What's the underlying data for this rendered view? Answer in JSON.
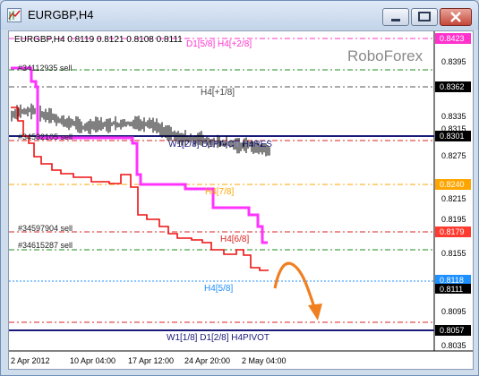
{
  "window": {
    "title": "EURGBP,H4"
  },
  "chart": {
    "info": "EURGBP,H4  0.8119 0.8121 0.8108 0.8111",
    "watermark": "RoboForex",
    "price_axis": {
      "ticks": [
        "0.8395",
        "0.8335",
        "0.8315",
        "0.8275",
        "0.8215",
        "0.8195",
        "0.8155",
        "0.8095",
        "0.8035"
      ]
    },
    "price_boxes": [
      {
        "value": "0.8423",
        "color": "#ff33cc"
      },
      {
        "value": "0.8362",
        "color": "#000000"
      },
      {
        "value": "0.8301",
        "color": "#000000"
      },
      {
        "value": "0.8240",
        "color": "#ffa500"
      },
      {
        "value": "0.8179",
        "color": "#ff3b30"
      },
      {
        "value": "0.8118",
        "color": "#1e90ff"
      },
      {
        "value": "0.8111",
        "color": "#000000"
      },
      {
        "value": "0.8057",
        "color": "#000000"
      }
    ],
    "time_axis": [
      "2 Apr 2012",
      "10 Apr 04:00",
      "17 Apr 12:00",
      "24 Apr 20:00",
      "2 May 04:00"
    ],
    "level_labels": {
      "d1_5_8": "D1[5/8] H4[+2/8]",
      "h4_1_8": "H4[+1/8]",
      "w1_pivot": "W1[2/8] D1PIVOT H4RES",
      "h4_7_8": "H4[7/8]",
      "h4_6_8": "H4[6/8]",
      "h4_5_8": "H4[5/8]",
      "w1_bottom": "W1[1/8] D1[2/8] H4PIVOT"
    },
    "order_labels": [
      "#34112935 sell",
      "#34582105 sell",
      "#34597904 sell",
      "#34615287 sell"
    ],
    "colors": {
      "magenta_line": "#ff33ff",
      "red_line": "#ee1111",
      "navy_line": "#1a1a7a",
      "arrow": "#f07f1f"
    }
  }
}
